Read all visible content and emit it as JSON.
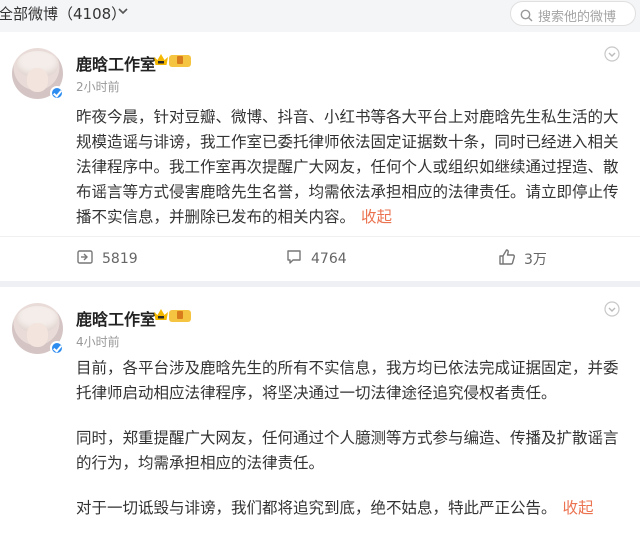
{
  "header": {
    "tab_label": "全部微博（4108）",
    "dropdown_icon": "chevron-down-icon",
    "search_placeholder": "搜索他的微博"
  },
  "posts": [
    {
      "author": "鹿晗工作室",
      "time": "2小时前",
      "text": "昨夜今晨，针对豆瓣、微博、抖音、小红书等各大平台上对鹿晗先生私生活的大规模造谣与诽谤，我工作室已委托律师依法固定证据数十条，同时已经进入相关法律程序中。我工作室再次提醒广大网友，任何个人或组织如继续通过捏造、散布谣言等方式侵害鹿晗先生名誉，均需依法承担相应的法律责任。请立即停止传播不实信息，并删除已发布的相关内容。",
      "collapse": "收起",
      "reposts": "5819",
      "comments": "4764",
      "likes": "3万"
    },
    {
      "author": "鹿晗工作室",
      "time": "4小时前",
      "paragraphs": [
        "目前，各平台涉及鹿晗先生的所有不实信息，我方均已依法完成证据固定，并委托律师启动相应法律程序，将坚决通过一切法律途径追究侵权者责任。",
        "同时，郑重提醒广大网友，任何通过个人臆测等方式参与编造、传播及扩散谣言的行为，均需承担相应的法律责任。",
        "对于一切诋毁与诽谤，我们都将追究到底，绝不姑息，特此严正公告。"
      ],
      "collapse": "收起"
    }
  ],
  "colors": {
    "accent": "#eb7350",
    "verified": "#2d8cf0",
    "crown": "#f5b800"
  }
}
